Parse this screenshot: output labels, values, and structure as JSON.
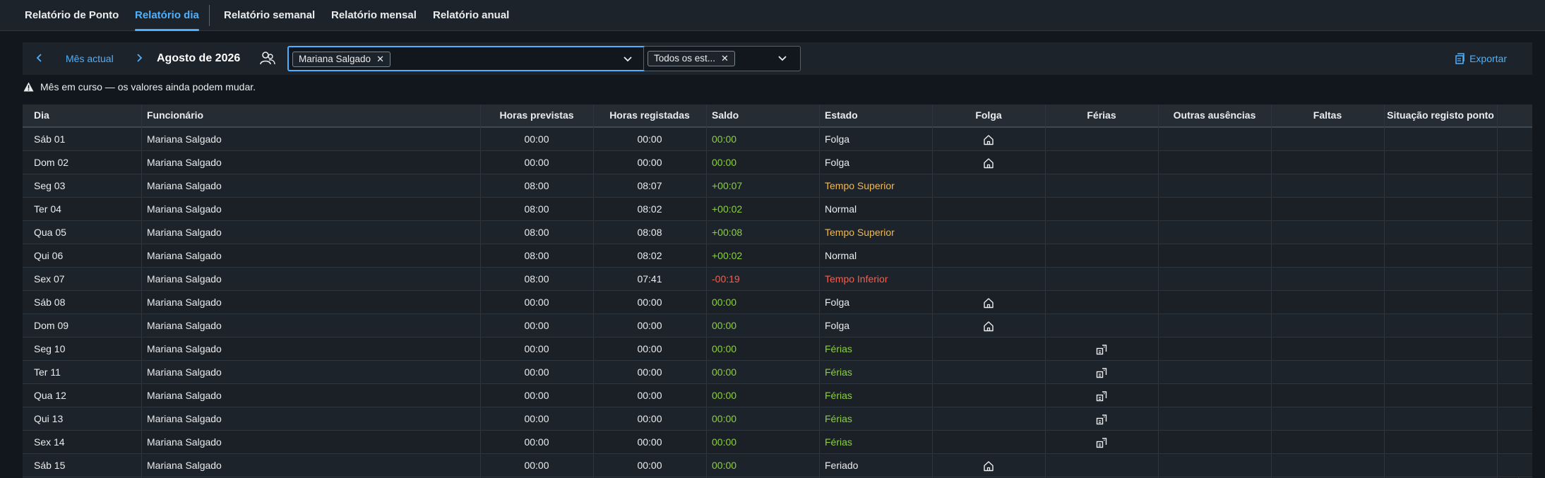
{
  "tabs": [
    {
      "label": "Relatório de Ponto",
      "active": false
    },
    {
      "label": "Relatório dia",
      "active": true
    },
    {
      "label": "Relatório semanal",
      "active": false
    },
    {
      "label": "Relatório mensal",
      "active": false
    },
    {
      "label": "Relatório anual",
      "active": false
    }
  ],
  "toolbar": {
    "current_month_label": "Mês actual",
    "month_title": "Agosto de 2026",
    "employee_token": "Mariana Salgado",
    "state_token": "Todos os est...",
    "export_label": "Exportar"
  },
  "warning": "Mês em curso — os valores ainda podem mudar.",
  "colors": {
    "accent": "#4db1ff",
    "positive": "#8ad13b",
    "negative": "#ff5a4a",
    "warning": "#f5b84a",
    "background": "#12171d"
  },
  "table": {
    "headers": {
      "dia": "Dia",
      "funcionario": "Funcionário",
      "horas_previstas": "Horas previstas",
      "horas_registadas": "Horas registadas",
      "saldo": "Saldo",
      "estado": "Estado",
      "folga": "Folga",
      "ferias": "Férias",
      "outras": "Outras ausências",
      "faltas": "Faltas",
      "situacao": "Situação registo ponto"
    },
    "rows": [
      {
        "dia": "Sáb 01",
        "funcionario": "Mariana Salgado",
        "previstas": "00:00",
        "registadas": "00:00",
        "saldo": "00:00",
        "estado": "Folga",
        "icon": "home-icon"
      },
      {
        "dia": "Dom 02",
        "funcionario": "Mariana Salgado",
        "previstas": "00:00",
        "registadas": "00:00",
        "saldo": "00:00",
        "estado": "Folga",
        "icon": "home-icon"
      },
      {
        "dia": "Seg 03",
        "funcionario": "Mariana Salgado",
        "previstas": "08:00",
        "registadas": "08:07",
        "saldo": "+00:07",
        "estado": "Tempo Superior",
        "icon": ""
      },
      {
        "dia": "Ter 04",
        "funcionario": "Mariana Salgado",
        "previstas": "08:00",
        "registadas": "08:02",
        "saldo": "+00:02",
        "estado": "Normal",
        "icon": ""
      },
      {
        "dia": "Qua 05",
        "funcionario": "Mariana Salgado",
        "previstas": "08:00",
        "registadas": "08:08",
        "saldo": "+00:08",
        "estado": "Tempo Superior",
        "icon": ""
      },
      {
        "dia": "Qui 06",
        "funcionario": "Mariana Salgado",
        "previstas": "08:00",
        "registadas": "08:02",
        "saldo": "+00:02",
        "estado": "Normal",
        "icon": ""
      },
      {
        "dia": "Sex 07",
        "funcionario": "Mariana Salgado",
        "previstas": "08:00",
        "registadas": "07:41",
        "saldo": "-00:19",
        "estado": "Tempo Inferior",
        "icon": ""
      },
      {
        "dia": "Sáb 08",
        "funcionario": "Mariana Salgado",
        "previstas": "00:00",
        "registadas": "00:00",
        "saldo": "00:00",
        "estado": "Folga",
        "icon": "home-icon"
      },
      {
        "dia": "Dom 09",
        "funcionario": "Mariana Salgado",
        "previstas": "00:00",
        "registadas": "00:00",
        "saldo": "00:00",
        "estado": "Folga",
        "icon": "home-icon"
      },
      {
        "dia": "Seg 10",
        "funcionario": "Mariana Salgado",
        "previstas": "00:00",
        "registadas": "00:00",
        "saldo": "00:00",
        "estado": "Férias",
        "icon": "vacation-icon"
      },
      {
        "dia": "Ter 11",
        "funcionario": "Mariana Salgado",
        "previstas": "00:00",
        "registadas": "00:00",
        "saldo": "00:00",
        "estado": "Férias",
        "icon": "vacation-icon"
      },
      {
        "dia": "Qua 12",
        "funcionario": "Mariana Salgado",
        "previstas": "00:00",
        "registadas": "00:00",
        "saldo": "00:00",
        "estado": "Férias",
        "icon": "vacation-icon"
      },
      {
        "dia": "Qui 13",
        "funcionario": "Mariana Salgado",
        "previstas": "00:00",
        "registadas": "00:00",
        "saldo": "00:00",
        "estado": "Férias",
        "icon": "vacation-icon"
      },
      {
        "dia": "Sex 14",
        "funcionario": "Mariana Salgado",
        "previstas": "00:00",
        "registadas": "00:00",
        "saldo": "00:00",
        "estado": "Férias",
        "icon": "vacation-icon"
      },
      {
        "dia": "Sáb 15",
        "funcionario": "Mariana Salgado",
        "previstas": "00:00",
        "registadas": "00:00",
        "saldo": "00:00",
        "estado": "Feriado",
        "icon": "home-icon"
      }
    ]
  }
}
